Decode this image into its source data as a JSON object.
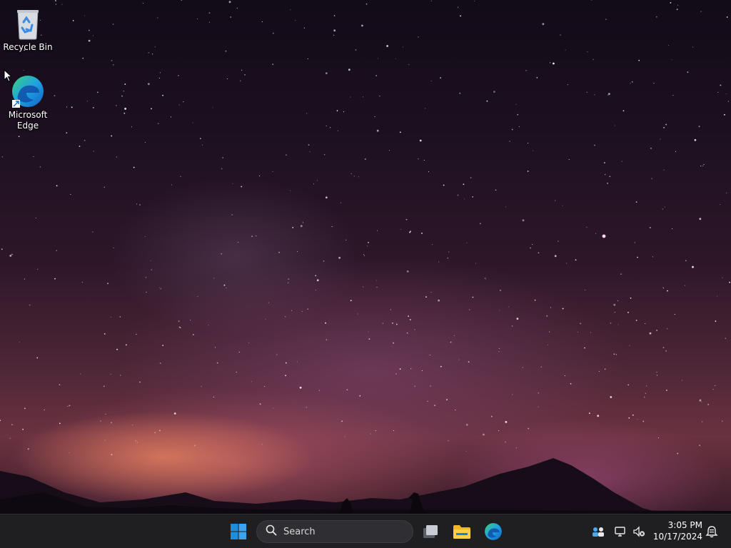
{
  "desktop": {
    "icons": [
      {
        "label": "Recycle Bin",
        "icon": "recycle-bin-icon"
      },
      {
        "label": "Microsoft Edge",
        "icon": "edge-icon"
      }
    ]
  },
  "taskbar": {
    "start": {
      "icon": "windows-start-icon"
    },
    "search": {
      "placeholder": "Search",
      "icon": "search-icon"
    },
    "pinned": [
      {
        "name": "Task View",
        "icon": "task-view-icon"
      },
      {
        "name": "File Explorer",
        "icon": "file-explorer-icon"
      },
      {
        "name": "Microsoft Edge",
        "icon": "edge-icon"
      }
    ],
    "tray": {
      "icons": [
        "people-icon",
        "network-icon",
        "volume-muted-icon"
      ],
      "time": "3:05 PM",
      "date": "10/17/2024",
      "notification_icon": "notification-bell-icon"
    }
  },
  "colors": {
    "taskbar_bg": "#1f1f22",
    "win_blue": "#1a8fe0",
    "edge_green": "#3ccf7d",
    "edge_blue": "#1472d6"
  }
}
